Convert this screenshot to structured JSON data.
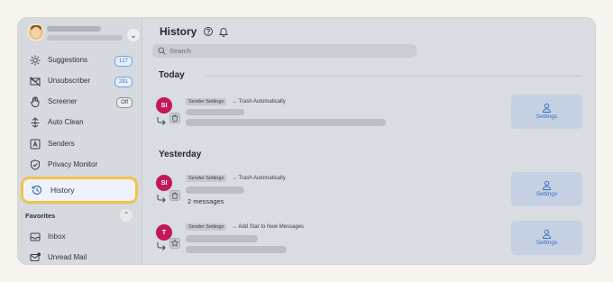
{
  "sidebar": {
    "items": [
      {
        "label": "Suggestions",
        "badge": "127",
        "icon": "sparkle-icon"
      },
      {
        "label": "Unsubscriber",
        "badge": "291",
        "icon": "unsubscribe-icon"
      },
      {
        "label": "Screener",
        "badge": "Off",
        "icon": "hand-icon"
      },
      {
        "label": "Auto Clean",
        "icon": "auto-clean-icon"
      },
      {
        "label": "Senders",
        "icon": "senders-icon"
      },
      {
        "label": "Privacy Monitor",
        "icon": "shield-icon"
      },
      {
        "label": "History",
        "icon": "history-icon"
      }
    ],
    "favorites_title": "Favorites",
    "favorites": [
      {
        "label": "Inbox",
        "icon": "inbox-icon"
      },
      {
        "label": "Unread Mail",
        "icon": "unread-mail-icon"
      }
    ]
  },
  "main": {
    "title": "History",
    "search_placeholder": "Search",
    "sections": [
      {
        "title": "Today",
        "rows": [
          {
            "avatar": "SI",
            "chip": "Sender Settings",
            "rule": "→ Trash Automatically",
            "subtext": "",
            "button": "Settings"
          }
        ]
      },
      {
        "title": "Yesterday",
        "rows": [
          {
            "avatar": "SI",
            "chip": "Sender Settings",
            "rule": "→ Trash Automatically",
            "subtext": "2 messages",
            "button": "Settings"
          },
          {
            "avatar": "T",
            "chip": "Sender Settings",
            "rule": "→ Add Star to New Messages",
            "subtext": "",
            "button": "Settings"
          }
        ]
      }
    ]
  },
  "colors": {
    "accent": "#3a6fc4",
    "avatar": "#c2185b",
    "highlight": "#f3c24a"
  }
}
